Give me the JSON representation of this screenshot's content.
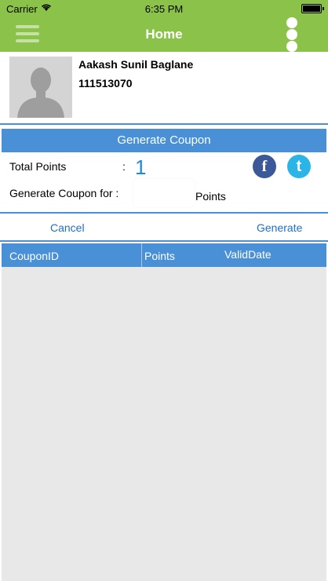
{
  "status_bar": {
    "carrier": "Carrier",
    "time": "6:35 PM"
  },
  "nav": {
    "title": "Home",
    "menu_icon": "hamburger-menu-icon",
    "more_icon": "more-vertical-icon"
  },
  "profile": {
    "name": "Aakash Sunil Baglane",
    "id": "111513070"
  },
  "coupon": {
    "header": "Generate Coupon",
    "total_points_label": "Total Points",
    "colon": ":",
    "total_points_value": "1",
    "generate_for_label": "Generate Coupon for :",
    "points_unit": "Points",
    "input_value": ""
  },
  "social": {
    "facebook_glyph": "f",
    "twitter_glyph": "t"
  },
  "actions": {
    "cancel": "Cancel",
    "generate": "Generate"
  },
  "table": {
    "columns": [
      "CouponID",
      "Points",
      "ValidDate"
    ],
    "rows": []
  },
  "colors": {
    "navbar": "#8bc34a",
    "accent_blue": "#4a90d6",
    "link_blue": "#1e6fc8",
    "empty_area": "#e8e8e8"
  }
}
